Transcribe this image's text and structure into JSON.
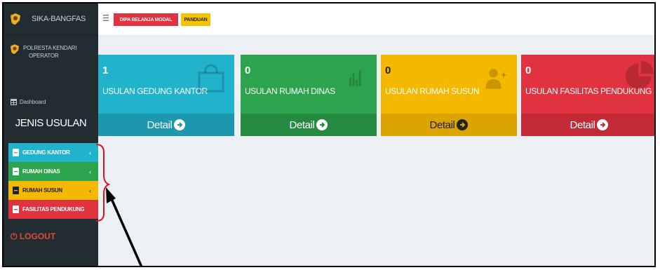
{
  "app": {
    "name": "SIKA-BANGFAS",
    "user_name": "POLRESTA KENDARI",
    "user_role": "OPERATOR"
  },
  "sidebar": {
    "dashboard_label": "Dashboard",
    "section_title": "JENIS USULAN",
    "items": [
      {
        "label": "GEDUNG KANTOR",
        "color": "#00c0ef"
      },
      {
        "label": "RUMAH DINAS",
        "color": "#00a65a"
      },
      {
        "label": "RUMAH SUSUN",
        "color": "#f39c12"
      },
      {
        "label": "FASILITAS PENDUKUNG",
        "color": "#dd4b39"
      }
    ],
    "logout_label": "LOGOUT"
  },
  "topbar": {
    "dipa_label": "DIPA BELANJA MODAL",
    "panduan_label": "PANDUAN"
  },
  "boxes": [
    {
      "count": "1",
      "title": "USULAN GEDUNG KANTOR",
      "detail": "Detail",
      "icon": "shopping-bag-icon",
      "color": "#22b3cc",
      "footer_color": "#1c97ad"
    },
    {
      "count": "0",
      "title": "USULAN RUMAH DINAS",
      "detail": "Detail",
      "icon": "bar-chart-icon",
      "color": "#2ca34d",
      "footer_color": "#248a40"
    },
    {
      "count": "0",
      "title": "USULAN RUMAH SUSUN",
      "detail": "Detail",
      "icon": "user-add-icon",
      "color": "#f5b800",
      "footer_color": "#dba400"
    },
    {
      "count": "0",
      "title": "USULAN FASILITAS PENDUKUNG",
      "detail": "Detail",
      "icon": "pie-chart-icon",
      "color": "#e0333f",
      "footer_color": "#c42a35"
    }
  ]
}
